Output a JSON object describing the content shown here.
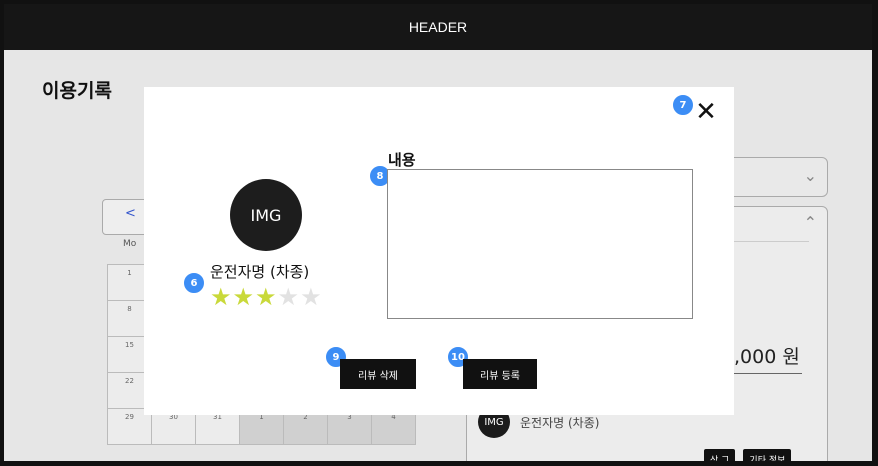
{
  "header": {
    "title": "HEADER"
  },
  "page": {
    "title": "이용기록"
  },
  "calendar": {
    "prev_label": "<",
    "weekday": "Mo",
    "rows": [
      [
        "1",
        "",
        "",
        "",
        "",
        "",
        ""
      ],
      [
        "8",
        "",
        "",
        "",
        "",
        "",
        ""
      ],
      [
        "15",
        "",
        "",
        "",
        "",
        "",
        ""
      ],
      [
        "22",
        "",
        "",
        "",
        "",
        "",
        ""
      ],
      [
        "29",
        "30",
        "31",
        "1",
        "2",
        "3",
        "4"
      ]
    ]
  },
  "background": {
    "price": ",000 원",
    "driver": "운전자명 (차종)",
    "avatar_text": "IMG",
    "button_1": "상 그",
    "button_2": "기타 정보"
  },
  "modal": {
    "avatar_text": "IMG",
    "driver_label": "운전자명 (차종)",
    "rating": 3,
    "rating_max": 5,
    "content_label": "내용",
    "content_value": "",
    "delete_button": "리뷰 삭제",
    "register_button": "리뷰 등록",
    "close_glyph": "✕"
  },
  "annotations": {
    "b6": "6",
    "b7": "7",
    "b8": "8",
    "b9": "9",
    "b10": "10"
  },
  "colors": {
    "badge": "#3c8df5",
    "star_on": "#c9d93a",
    "star_off": "#e2e2e2",
    "header_bg": "#161616"
  },
  "icons": {
    "close": "close-icon",
    "chevron_down": "chevron-down-icon",
    "chevron_up": "chevron-up-icon",
    "star": "star-icon"
  }
}
